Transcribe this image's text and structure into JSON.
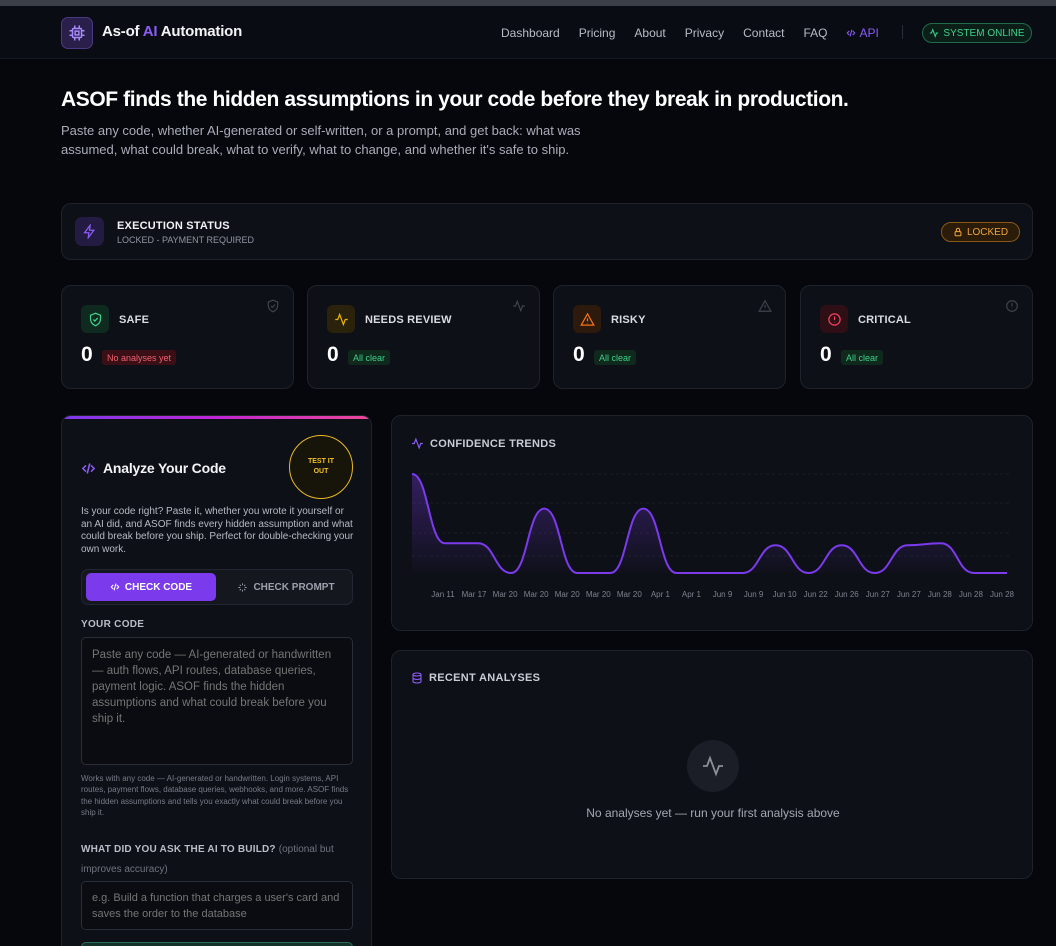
{
  "nav": {
    "brand_prefix": "As-of ",
    "brand_ai": "AI",
    "brand_suffix": " Automation",
    "links": [
      "Dashboard",
      "Pricing",
      "About",
      "Privacy",
      "Contact",
      "FAQ"
    ],
    "api_label": "API",
    "system_status": "SYSTEM ONLINE"
  },
  "hero": {
    "title": "ASOF finds the hidden assumptions in your code before they break in production.",
    "subtitle": "Paste any code, whether AI-generated or self-written, or a prompt, and get back: what was assumed, what could break, what to verify, what to change, and whether it's safe to ship."
  },
  "execution": {
    "title": "EXECUTION STATUS",
    "subtitle": "LOCKED - PAYMENT REQUIRED",
    "badge": "LOCKED"
  },
  "stats": [
    {
      "label": "SAFE",
      "value": "0",
      "tag": "No analyses yet",
      "icon": "shield-check-icon",
      "color": "#3fd08c"
    },
    {
      "label": "NEEDS REVIEW",
      "value": "0",
      "tag": "All clear",
      "icon": "pulse-icon",
      "color": "#eab308"
    },
    {
      "label": "RISKY",
      "value": "0",
      "tag": "All clear",
      "icon": "warning-triangle-icon",
      "color": "#f97316"
    },
    {
      "label": "CRITICAL",
      "value": "0",
      "tag": "All clear",
      "icon": "alert-circle-icon",
      "color": "#f43f5e"
    }
  ],
  "analyze": {
    "title": "Analyze Your Code",
    "test_button": "TEST IT OUT",
    "description": "Is your code right? Paste it, whether you wrote it yourself or an AI did, and ASOF finds every hidden assumption and what could break before you ship. Perfect for double-checking your own work.",
    "mode_check_code": "CHECK CODE",
    "mode_check_prompt": "CHECK PROMPT",
    "code_label": "YOUR CODE",
    "code_placeholder": "Paste any code — AI-generated or handwritten — auth flows, API routes, database queries, payment logic. ASOF finds the hidden assumptions and what could break before you ship it.",
    "code_help": "Works with any code — AI-generated or handwritten. Login systems, API routes, payment flows, database queries, webhooks, and more. ASOF finds the hidden assumptions and tells you exactly what could break before you ship it.",
    "ask_label": "WHAT DID YOU ASK THE AI TO BUILD?",
    "ask_optional": "(optional but improves accuracy)",
    "ask_placeholder": "e.g. Build a function that charges a user's card and saves the order to the database"
  },
  "chart_data": {
    "type": "area",
    "title": "CONFIDENCE TRENDS",
    "categories": [
      "Jan 11",
      "Mar 17",
      "Mar 20",
      "Mar 20",
      "Mar 20",
      "Mar 20",
      "Mar 20",
      "Apr 1",
      "Apr 1",
      "Jun 9",
      "Jun 9",
      "Jun 10",
      "Jun 22",
      "Jun 26",
      "Jun 27",
      "Jun 27",
      "Jun 28",
      "Jun 28",
      "Jun 28"
    ],
    "values": [
      100,
      30,
      30,
      0,
      65,
      0,
      0,
      65,
      0,
      0,
      0,
      28,
      0,
      28,
      0,
      28,
      30,
      0,
      0
    ],
    "color": "#7c3aed"
  },
  "recent": {
    "title": "RECENT ANALYSES",
    "empty_text": "No analyses yet — run your first analysis above"
  }
}
